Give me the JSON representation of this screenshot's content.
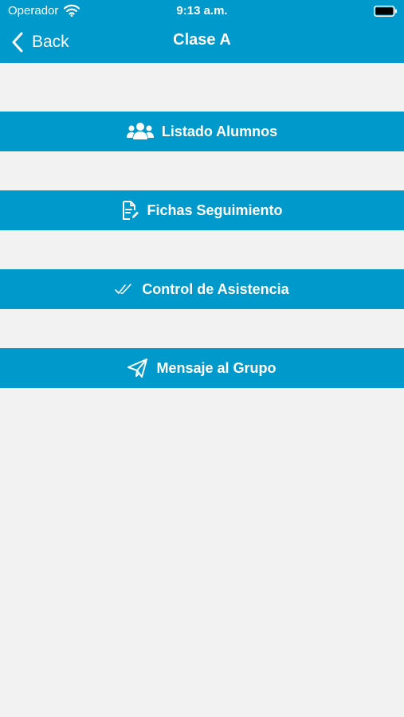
{
  "status_bar": {
    "carrier": "Operador",
    "time": "9:13 a.m.",
    "wifi_icon": "wifi-icon",
    "battery_icon": "battery-icon"
  },
  "nav": {
    "back_label": "Back",
    "title": "Clase A",
    "back_icon": "chevron-left-icon"
  },
  "menu": [
    {
      "label": "Listado Alumnos",
      "icon": "users-icon"
    },
    {
      "label": "Fichas Seguimiento",
      "icon": "document-edit-icon"
    },
    {
      "label": "Control de Asistencia",
      "icon": "double-check-icon"
    },
    {
      "label": "Mensaje al Grupo",
      "icon": "paper-plane-icon"
    }
  ],
  "colors": {
    "primary": "#0099cc",
    "background": "#f2f2f2",
    "text_on_primary": "#ffffff"
  }
}
